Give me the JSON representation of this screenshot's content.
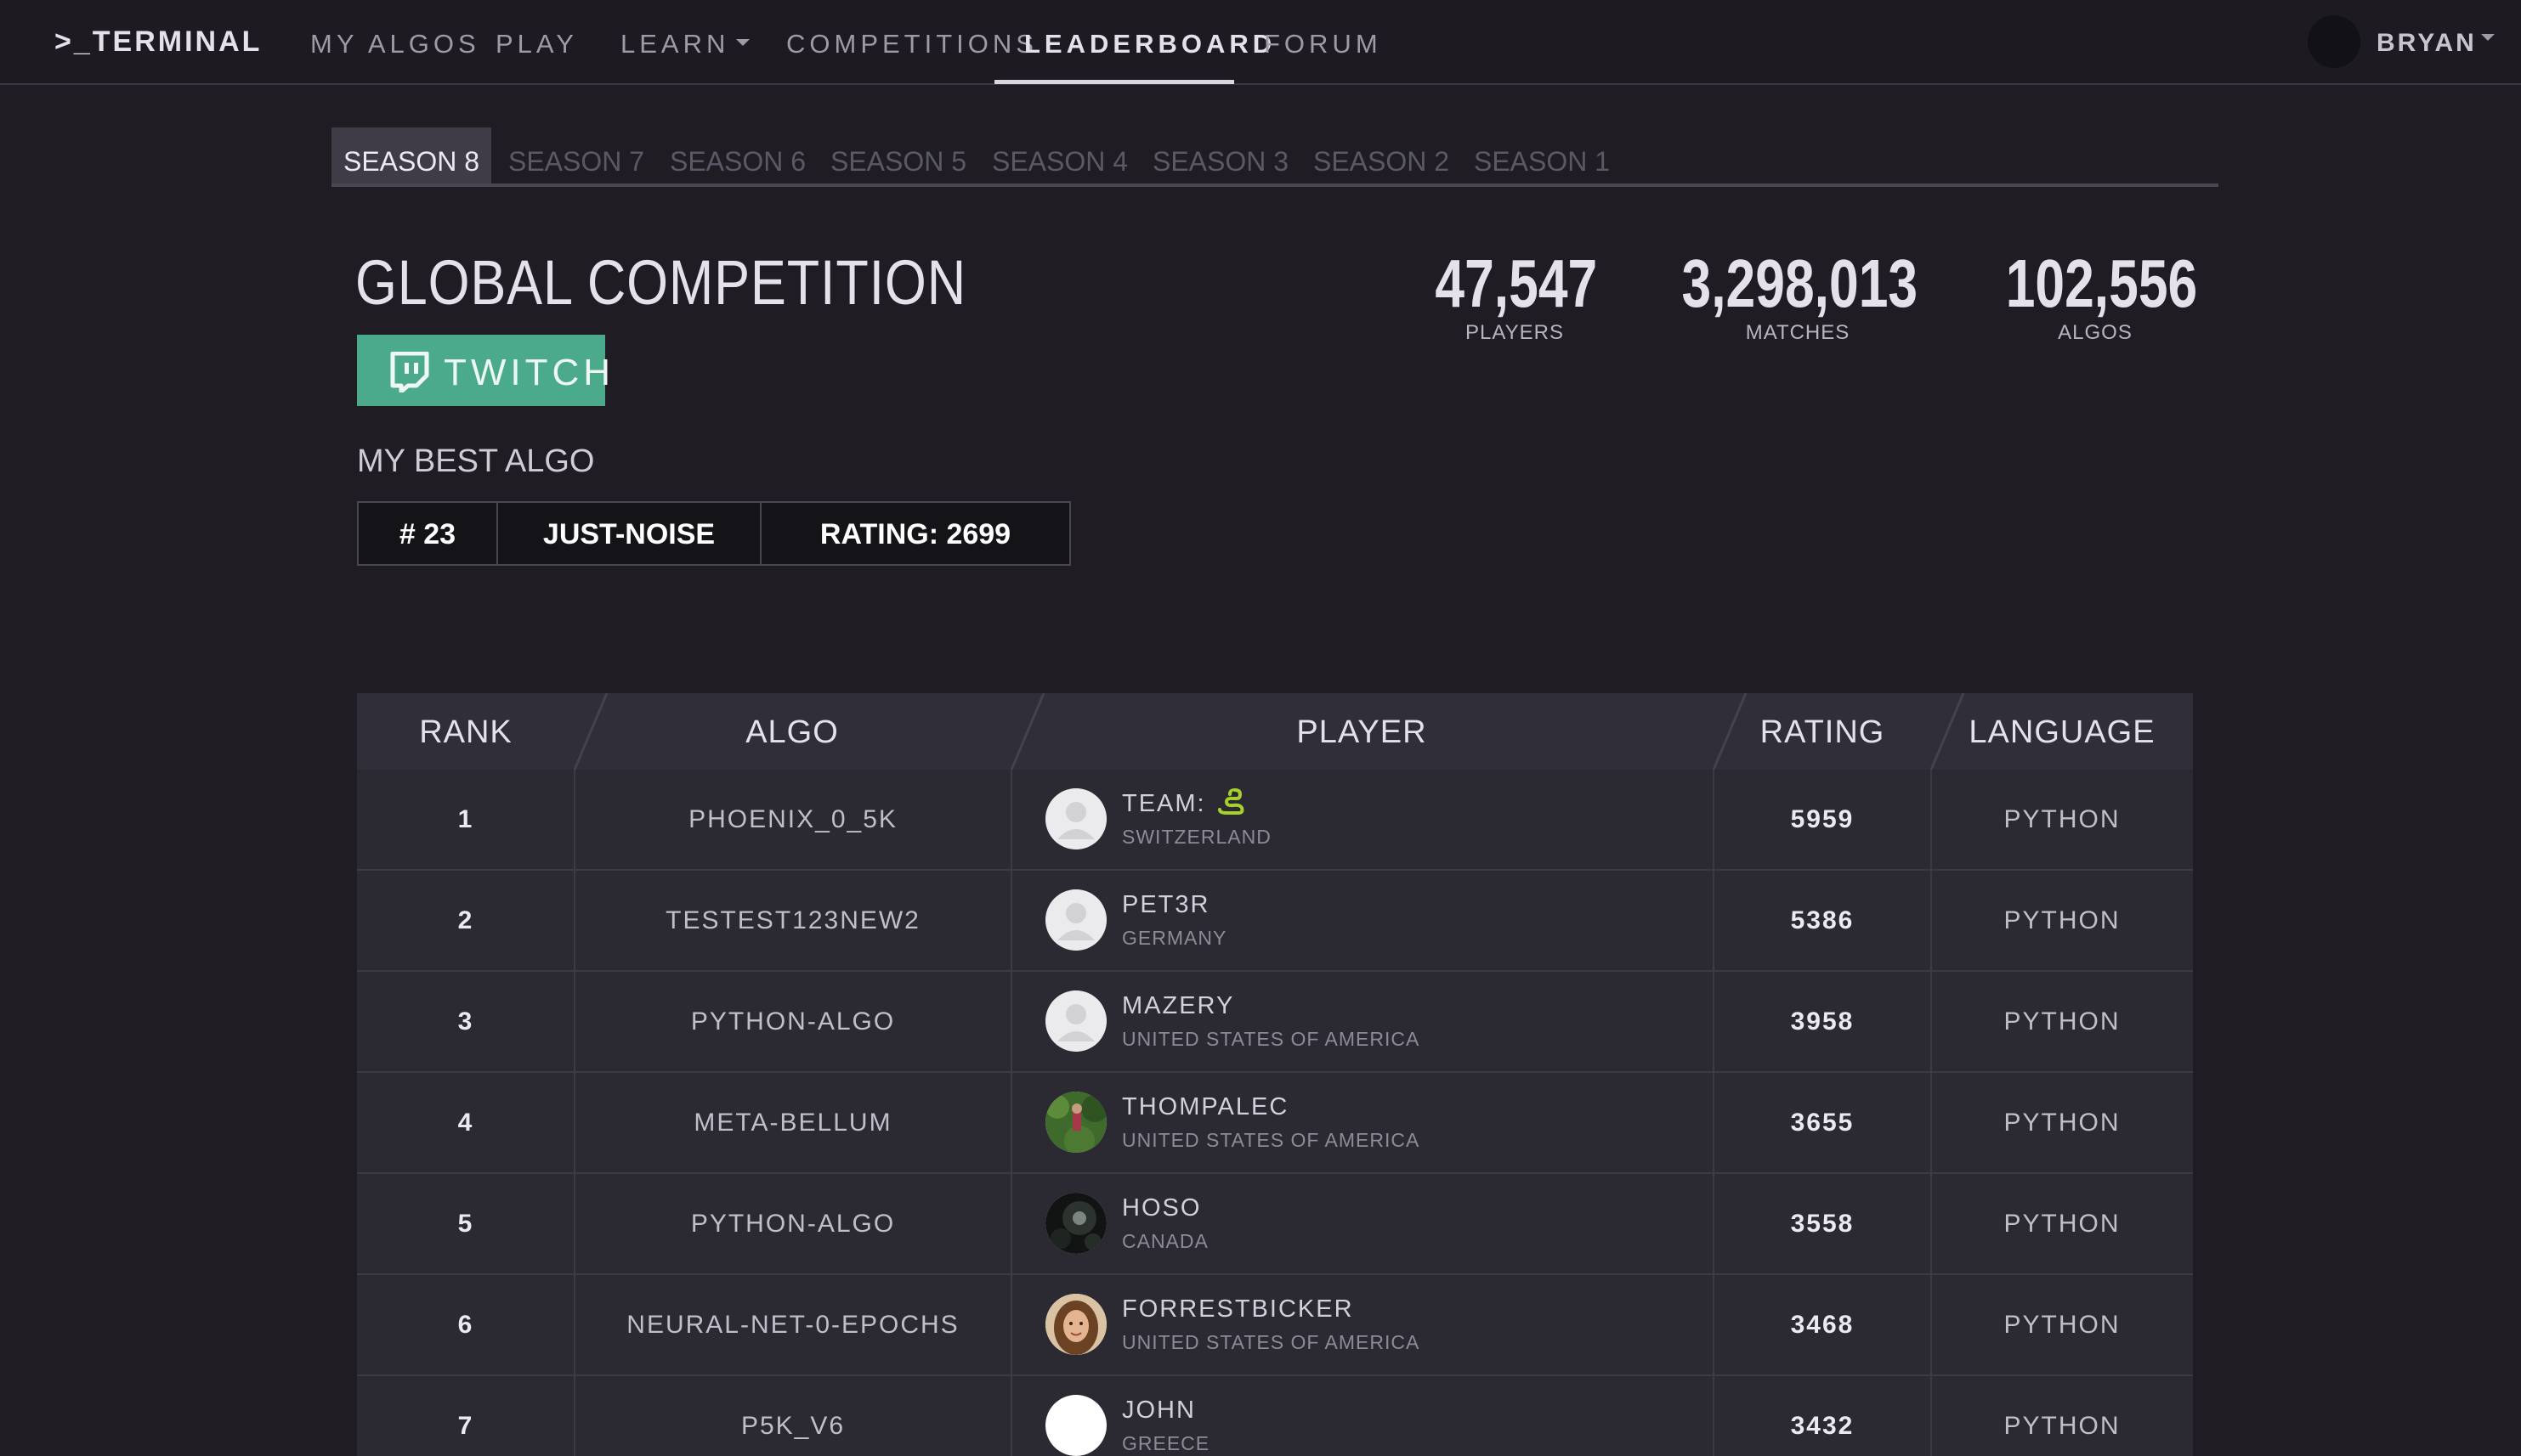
{
  "nav": {
    "logo": ">_TERMINAL",
    "items": [
      {
        "label": "MY ALGOS"
      },
      {
        "label": "PLAY"
      },
      {
        "label": "LEARN"
      },
      {
        "label": "COMPETITIONS"
      },
      {
        "label": "LEADERBOARD",
        "active": true
      },
      {
        "label": "FORUM"
      }
    ],
    "user": "BRYAN"
  },
  "seasons": [
    "SEASON 8",
    "SEASON 7",
    "SEASON 6",
    "SEASON 5",
    "SEASON 4",
    "SEASON 3",
    "SEASON 2",
    "SEASON 1"
  ],
  "active_season": "SEASON 8",
  "header": {
    "title": "GLOBAL COMPETITION",
    "twitch_label": "TWITCH",
    "best_algo_label": "MY BEST ALGO",
    "best_algo": {
      "rank": "# 23",
      "name": "JUST-NOISE",
      "rating": "RATING: 2699"
    }
  },
  "stats": [
    {
      "value": "47,547",
      "label": "PLAYERS"
    },
    {
      "value": "3,298,013",
      "label": "MATCHES"
    },
    {
      "value": "102,556",
      "label": "ALGOS"
    }
  ],
  "table": {
    "columns": [
      "RANK",
      "ALGO",
      "PLAYER",
      "RATING",
      "LANGUAGE"
    ],
    "rows": [
      {
        "rank": "1",
        "algo": "PHOENIX_0_5K",
        "player": "TEAM:",
        "country": "SWITZERLAND",
        "rating": "5959",
        "language": "PYTHON",
        "avatar": "default",
        "team_icon": "snake-icon"
      },
      {
        "rank": "2",
        "algo": "TESTEST123NEW2",
        "player": "PET3R",
        "country": "GERMANY",
        "rating": "5386",
        "language": "PYTHON",
        "avatar": "default"
      },
      {
        "rank": "3",
        "algo": "PYTHON-ALGO",
        "player": "MAZERY",
        "country": "UNITED STATES OF AMERICA",
        "rating": "3958",
        "language": "PYTHON",
        "avatar": "default"
      },
      {
        "rank": "4",
        "algo": "META-BELLUM",
        "player": "THOMPALEC",
        "country": "UNITED STATES OF AMERICA",
        "rating": "3655",
        "language": "PYTHON",
        "avatar": "forest"
      },
      {
        "rank": "5",
        "algo": "PYTHON-ALGO",
        "player": "HOSO",
        "country": "CANADA",
        "rating": "3558",
        "language": "PYTHON",
        "avatar": "night"
      },
      {
        "rank": "6",
        "algo": "NEURAL-NET-0-EPOCHS",
        "player": "FORRESTBICKER",
        "country": "UNITED STATES OF AMERICA",
        "rating": "3468",
        "language": "PYTHON",
        "avatar": "portrait"
      },
      {
        "rank": "7",
        "algo": "P5K_V6",
        "player": "JOHN",
        "country": "GREECE",
        "rating": "3432",
        "language": "PYTHON",
        "avatar": "blank"
      }
    ]
  },
  "colors": {
    "background": "#1f1d23",
    "twitch": "#4caa8c",
    "table": "#2b2932"
  }
}
